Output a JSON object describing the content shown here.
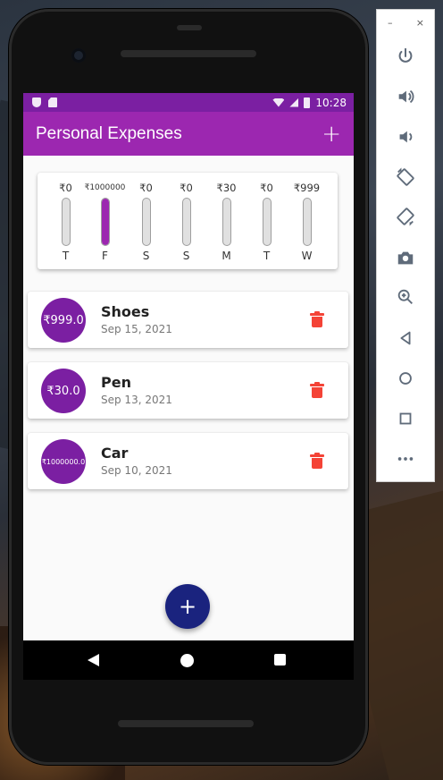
{
  "status_bar": {
    "time": "10:28"
  },
  "app_bar": {
    "title": "Personal Expenses",
    "add_label": "+"
  },
  "chart": {
    "bars": [
      {
        "day": "T",
        "amount": "₹0",
        "fill": 0
      },
      {
        "day": "F",
        "amount": "₹1000000",
        "fill": 1.0
      },
      {
        "day": "S",
        "amount": "₹0",
        "fill": 0
      },
      {
        "day": "S",
        "amount": "₹0",
        "fill": 0
      },
      {
        "day": "M",
        "amount": "₹30",
        "fill": 0
      },
      {
        "day": "T",
        "amount": "₹0",
        "fill": 0
      },
      {
        "day": "W",
        "amount": "₹999",
        "fill": 0
      }
    ]
  },
  "transactions": [
    {
      "amount": "₹999.0",
      "title": "Shoes",
      "date": "Sep 15, 2021"
    },
    {
      "amount": "₹30.0",
      "title": "Pen",
      "date": "Sep 13, 2021"
    },
    {
      "amount": "₹1000000.0",
      "title": "Car",
      "date": "Sep 10, 2021"
    }
  ],
  "fab": {
    "label": "+"
  },
  "emulator_toolbar": {
    "minimize": "–",
    "close": "×",
    "buttons": [
      "power-icon",
      "volume-up-icon",
      "volume-down-icon",
      "rotate-left-icon",
      "rotate-right-icon",
      "camera-icon",
      "zoom-icon",
      "back-icon",
      "home-icon",
      "overview-icon",
      "more-icon"
    ]
  },
  "colors": {
    "primary": "#9c27b0",
    "status_bar": "#7b1fa2",
    "fab": "#1a237e",
    "delete": "#f44336"
  }
}
